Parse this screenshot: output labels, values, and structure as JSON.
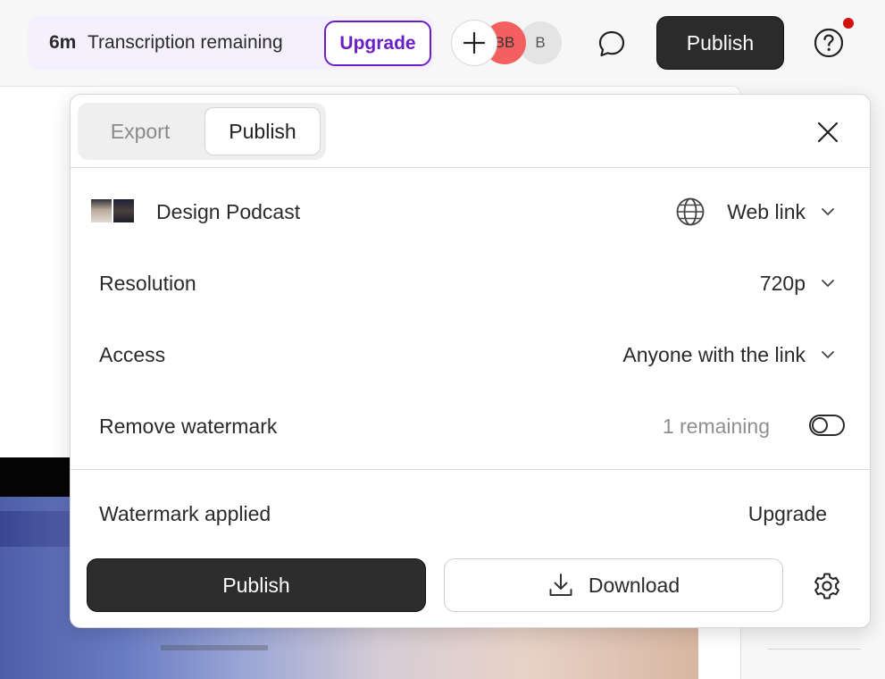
{
  "topbar": {
    "transcription_amount": "6m",
    "transcription_label": "Transcription remaining",
    "upgrade_label": "Upgrade",
    "avatars": [
      "BB",
      "B"
    ],
    "publish_label": "Publish"
  },
  "panel": {
    "tabs": [
      {
        "label": "Export",
        "active": false
      },
      {
        "label": "Publish",
        "active": true
      }
    ],
    "project_name": "Design Podcast",
    "destination": "Web link",
    "settings": [
      {
        "label": "Resolution",
        "value": "720p"
      },
      {
        "label": "Access",
        "value": "Anyone with the link"
      }
    ],
    "watermark": {
      "label": "Remove watermark",
      "remaining": "1 remaining",
      "enabled": false
    },
    "applied": {
      "label": "Watermark applied",
      "action": "Upgrade"
    },
    "publish_button": "Publish",
    "download_button": "Download"
  },
  "colors": {
    "upgrade_accent": "#6a1fc6",
    "avatar_bb": "#f46060",
    "notification_dot": "#d50f0f",
    "primary_button": "#2d2d2d"
  },
  "icons": [
    "plus-icon",
    "comment-icon",
    "help-icon",
    "close-icon",
    "globe-icon",
    "chevron-down-icon",
    "download-icon",
    "gear-icon"
  ]
}
